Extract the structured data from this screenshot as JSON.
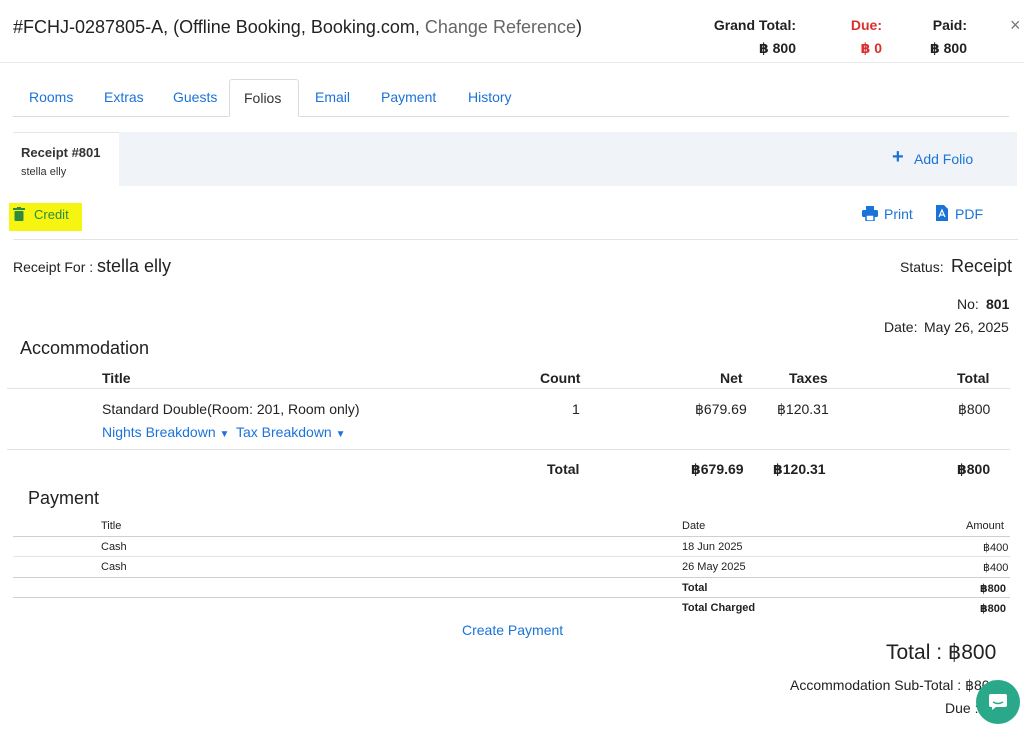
{
  "header": {
    "booking_ref": "#FCHJ-0287805-A, (Offline Booking, Booking.com,",
    "change_ref_label": "Change Reference",
    "close_glyph": "×",
    "summary": {
      "grand_total_label": "Grand Total:",
      "grand_total_value": "฿ 800",
      "due_label": "Due:",
      "due_value": "฿ 0",
      "paid_label": "Paid:",
      "paid_value": "฿ 800",
      "due_color": "#d9302c"
    }
  },
  "tabs": [
    {
      "label": "Rooms"
    },
    {
      "label": "Extras"
    },
    {
      "label": "Guests"
    },
    {
      "label": "Folios",
      "active": true
    },
    {
      "label": "Email"
    },
    {
      "label": "Payment"
    },
    {
      "label": "History"
    }
  ],
  "folio": {
    "card_title": "Receipt #801",
    "card_name": "stella elly",
    "add_folio_label": "Add Folio",
    "credit_label": "Credit",
    "print_label": "Print",
    "pdf_label": "PDF"
  },
  "receipt": {
    "for_label": "Receipt For :",
    "for_name": "stella elly",
    "status_label": "Status:",
    "status_value": "Receipt",
    "no_label": "No:",
    "no_value": "801",
    "date_label": "Date:",
    "date_value": "May 26, 2025"
  },
  "accommodation": {
    "heading": "Accommodation",
    "columns": [
      "Title",
      "Count",
      "Net",
      "Taxes",
      "Total"
    ],
    "row": {
      "title": "Standard Double(Room: 201, Room only)",
      "count": "1",
      "net": "฿679.69",
      "taxes": "฿120.31",
      "total": "฿800",
      "nights_link": "Nights Breakdown",
      "tax_link": "Tax Breakdown"
    },
    "totals": {
      "label": "Total",
      "net": "฿679.69",
      "taxes": "฿120.31",
      "total": "฿800"
    }
  },
  "payment": {
    "heading": "Payment",
    "columns": [
      "Title",
      "Date",
      "Amount"
    ],
    "rows": [
      {
        "title": "Cash",
        "date": "18 Jun 2025",
        "amount": "฿400"
      },
      {
        "title": "Cash",
        "date": "26 May 2025",
        "amount": "฿400"
      }
    ],
    "total_label": "Total",
    "total_value": "฿800",
    "total_charged_label": "Total Charged",
    "total_charged_value": "฿800",
    "create_payment_label": "Create Payment"
  },
  "footer": {
    "total_label": "Total : ฿800",
    "subtotal_label": "Accommodation Sub-Total : ฿800",
    "due_label": "Due :"
  },
  "colors": {
    "link": "#1a73d9",
    "highlight": "#f5f511",
    "chat": "#2aa88a"
  }
}
